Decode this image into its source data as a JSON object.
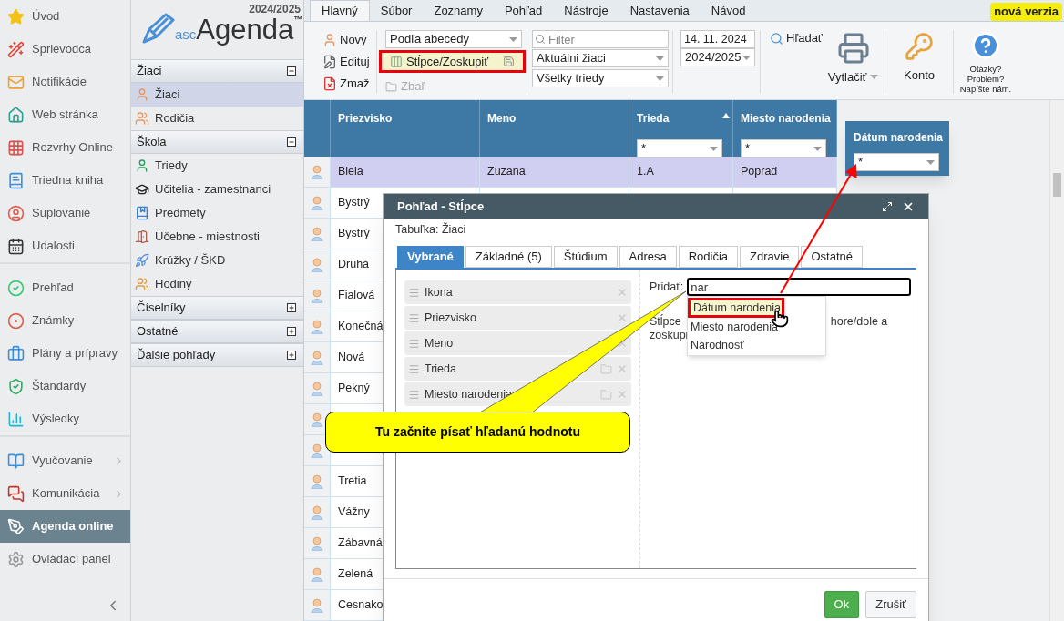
{
  "sidebar": {
    "groups": [
      {
        "items": [
          {
            "label": "Úvod",
            "selected": false,
            "submenu": false
          },
          {
            "label": "Sprievodca",
            "selected": false,
            "submenu": false
          },
          {
            "label": "Notifikácie",
            "selected": false,
            "submenu": false
          },
          {
            "label": "Web stránka",
            "selected": false,
            "submenu": false
          },
          {
            "label": "Rozvrhy Online",
            "selected": false,
            "submenu": false
          },
          {
            "label": "Triedna kniha",
            "selected": false,
            "submenu": false
          },
          {
            "label": "Suplovanie",
            "selected": false,
            "submenu": false
          },
          {
            "label": "Udalosti",
            "selected": false,
            "submenu": false
          }
        ]
      },
      {
        "items": [
          {
            "label": "Prehľad",
            "selected": false,
            "submenu": false
          },
          {
            "label": "Známky",
            "selected": false,
            "submenu": false
          },
          {
            "label": "Plány a prípravy",
            "selected": false,
            "submenu": false
          },
          {
            "label": "Štandardy",
            "selected": false,
            "submenu": false
          },
          {
            "label": "Výsledky",
            "selected": false,
            "submenu": false
          }
        ]
      },
      {
        "items": [
          {
            "label": "Vyučovanie",
            "selected": false,
            "submenu": true
          },
          {
            "label": "Komunikácia",
            "selected": false,
            "submenu": true
          },
          {
            "label": "Agenda online",
            "selected": true,
            "submenu": false
          },
          {
            "label": "Ovládací panel",
            "selected": false,
            "submenu": false
          }
        ]
      }
    ]
  },
  "nav_panel": {
    "year": "2024/2025",
    "logo": {
      "prefix": "asc",
      "name": "Agenda",
      "mark": "™"
    },
    "sections": [
      {
        "title": "Žiaci",
        "expanded": true,
        "items": [
          {
            "label": "Žiaci",
            "selected": true
          },
          {
            "label": "Rodičia",
            "selected": false
          }
        ]
      },
      {
        "title": "Škola",
        "expanded": true,
        "items": [
          {
            "label": "Triedy",
            "selected": false
          },
          {
            "label": "Učitelia - zamestnanci",
            "selected": false
          },
          {
            "label": "Predmety",
            "selected": false
          },
          {
            "label": "Učebne - miestnosti",
            "selected": false
          },
          {
            "label": "Krúžky / ŠKD",
            "selected": false
          },
          {
            "label": "Hodiny",
            "selected": false
          }
        ]
      },
      {
        "title": "Číselníky",
        "expanded": false
      },
      {
        "title": "Ostatné",
        "expanded": false
      },
      {
        "title": "Ďalšie pohľady",
        "expanded": false
      }
    ]
  },
  "menu_tabs": [
    {
      "label": "Hlavný",
      "selected": true
    },
    {
      "label": "Súbor",
      "selected": false
    },
    {
      "label": "Zoznamy",
      "selected": false
    },
    {
      "label": "Pohľad",
      "selected": false
    },
    {
      "label": "Nástroje",
      "selected": false
    },
    {
      "label": "Nastavenia",
      "selected": false
    },
    {
      "label": "Návod",
      "selected": false
    }
  ],
  "new_version_badge": "nová verzia",
  "ribbon": {
    "record_actions": [
      "Nový",
      "Edituj",
      "Zmaž"
    ],
    "sort_select": "Podľa abecedy",
    "columns_button": {
      "label": "Stĺpce/Zoskupiť",
      "highlighted": true
    },
    "collapse_button": {
      "label": "Zbaľ",
      "disabled": true
    },
    "filter": {
      "placeholder": "Filter"
    },
    "student_select": "Aktuálni žiaci",
    "class_select": "Všetky triedy",
    "date_field": "14. 11. 2024",
    "year_select": "2024/2025",
    "search_button": "Hľadať",
    "print_button": "Vytlačiť",
    "account_button": "Konto",
    "help_button": [
      "Otázky?",
      "Problém?",
      "Napíšte nám."
    ]
  },
  "grid": {
    "columns": [
      {
        "label": "Priezvisko"
      },
      {
        "label": "Meno"
      },
      {
        "label": "Trieda",
        "sorted_ascending": true,
        "filter": "*"
      },
      {
        "label": "Miesto narodenia",
        "filter": "*"
      }
    ],
    "rows": [
      {
        "cells": [
          "Biela",
          "Zuzana",
          "1.A",
          "Poprad"
        ],
        "selected": true
      },
      {
        "cells": [
          "Bystrý"
        ],
        "selected": false
      },
      {
        "cells": [
          "Bystrý"
        ],
        "selected": false
      },
      {
        "cells": [
          "Druhá"
        ],
        "selected": false
      },
      {
        "cells": [
          "Fialová"
        ],
        "selected": false
      },
      {
        "cells": [
          "Konečná"
        ],
        "selected": false
      },
      {
        "cells": [
          "Nová"
        ],
        "selected": false
      },
      {
        "cells": [
          "Pekný"
        ],
        "selected": false
      },
      {
        "selected": false
      },
      {
        "selected": false
      },
      {
        "cells": [
          "Tretia"
        ],
        "selected": false
      },
      {
        "cells": [
          "Vážny"
        ],
        "selected": false
      },
      {
        "cells": [
          "Zábavná"
        ],
        "selected": false
      },
      {
        "cells": [
          "Zelená"
        ],
        "selected": false
      },
      {
        "cells": [
          "Cesnako"
        ],
        "selected": false
      }
    ]
  },
  "floating_column": {
    "label": "Dátum narodenia",
    "filter": "*"
  },
  "dialog": {
    "title": "Pohľad - Stĺpce",
    "table_label": "Tabuľka: Žiaci",
    "tabs": [
      {
        "label": "Vybrané",
        "selected": true
      },
      {
        "label": "Základné (5)",
        "selected": false
      },
      {
        "label": "Štúdium",
        "selected": false
      },
      {
        "label": "Adresa",
        "selected": false
      },
      {
        "label": "Rodičia",
        "selected": false
      },
      {
        "label": "Zdravie",
        "selected": false
      },
      {
        "label": "Ostatné",
        "selected": false
      }
    ],
    "selected_columns": [
      {
        "label": "Ikona",
        "groupable": false
      },
      {
        "label": "Priezvisko",
        "groupable": false
      },
      {
        "label": "Meno",
        "groupable": false
      },
      {
        "label": "Trieda",
        "groupable": true
      },
      {
        "label": "Miesto narodenia",
        "groupable": true
      }
    ],
    "add_label": "Pridať:",
    "add_value": "nar",
    "suggestions": [
      {
        "label": "Dátum narodenia",
        "selected": true
      },
      {
        "label": "Miesto narodenia",
        "selected": false
      },
      {
        "label": "Národnosť",
        "selected": false
      }
    ],
    "hint_fragments": [
      "Stĺpce",
      "hore/dole a",
      "zoskupi"
    ],
    "buttons": [
      {
        "label": "Ok",
        "kind": "primary"
      },
      {
        "label": "Zrušiť",
        "kind": "secondary"
      }
    ]
  },
  "callout": "Tu začnite písať hľadanú hodnotu"
}
